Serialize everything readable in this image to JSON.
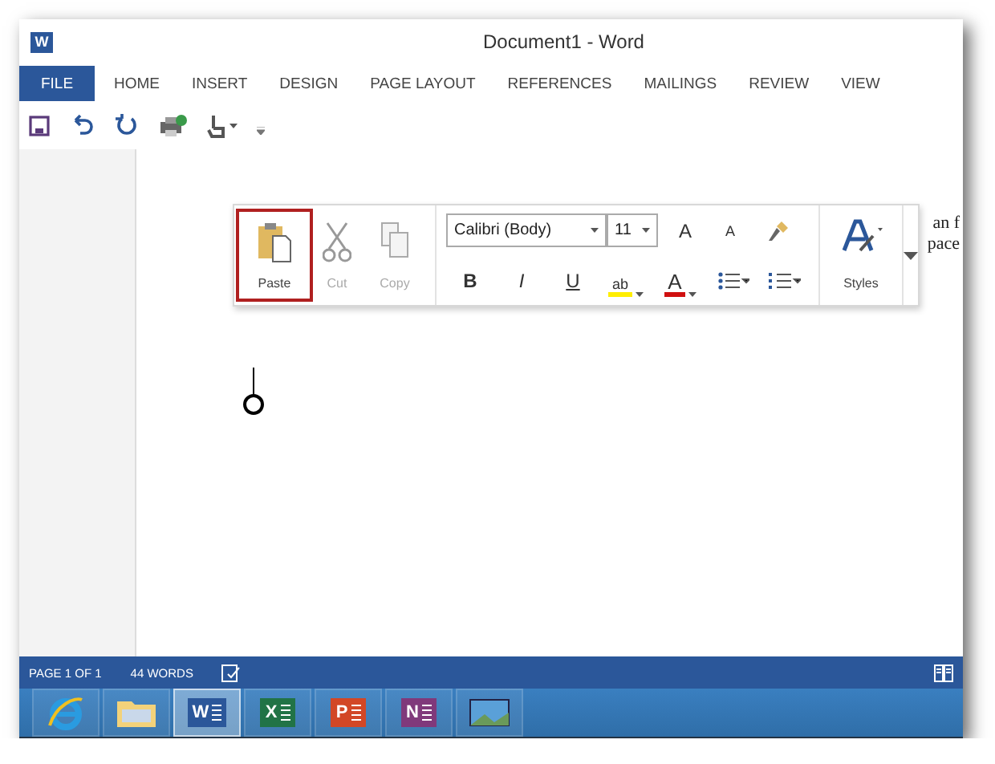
{
  "window": {
    "title": "Document1 - Word",
    "app_icon_letter": "W"
  },
  "tabs": [
    {
      "label": "FILE",
      "kind": "file"
    },
    {
      "label": "HOME",
      "kind": "tab"
    },
    {
      "label": "INSERT",
      "kind": "tab"
    },
    {
      "label": "DESIGN",
      "kind": "tab"
    },
    {
      "label": "PAGE LAYOUT",
      "kind": "tab"
    },
    {
      "label": "REFERENCES",
      "kind": "tab"
    },
    {
      "label": "MAILINGS",
      "kind": "tab"
    },
    {
      "label": "REVIEW",
      "kind": "tab"
    },
    {
      "label": "VIEW",
      "kind": "tab"
    }
  ],
  "quick_access": [
    {
      "kind": "save"
    },
    {
      "kind": "undo"
    },
    {
      "kind": "redo"
    },
    {
      "kind": "print"
    },
    {
      "kind": "touch"
    },
    {
      "kind": "customize"
    }
  ],
  "mini_toolbar": {
    "clipboard": [
      {
        "label": "Paste",
        "kind": "paste",
        "highlighted": true,
        "disabled": false
      },
      {
        "label": "Cut",
        "kind": "cut",
        "highlighted": false,
        "disabled": true
      },
      {
        "label": "Copy",
        "kind": "copy",
        "highlighted": false,
        "disabled": true
      }
    ],
    "font": {
      "value": "Calibri (Body)"
    },
    "size": {
      "value": "11"
    },
    "grow_label": "A",
    "shrink_label": "A",
    "format_buttons": [
      {
        "label": "B",
        "kind": "bold"
      },
      {
        "label": "I",
        "kind": "italic"
      },
      {
        "label": "U",
        "kind": "underline"
      }
    ],
    "color_buttons": [
      {
        "label": "ab",
        "kind": "highlight",
        "color": "#ffee00"
      },
      {
        "label": "A",
        "kind": "font",
        "color": "#d01010"
      }
    ],
    "styles_label": "Styles"
  },
  "document": {
    "text_fragments": [
      "an f",
      "pace"
    ]
  },
  "status_bar": {
    "page": "PAGE 1 OF 1",
    "words": "44 WORDS"
  },
  "taskbar": [
    {
      "kind": "browser",
      "selected": false
    },
    {
      "kind": "folder",
      "selected": false
    },
    {
      "kind": "app",
      "letter": "W",
      "color": "#2b579a",
      "selected": true
    },
    {
      "kind": "app",
      "letter": "X",
      "color": "#217346",
      "selected": false
    },
    {
      "kind": "app",
      "letter": "P",
      "color": "#d24726",
      "selected": false
    },
    {
      "kind": "app",
      "letter": "N",
      "color": "#80397b",
      "selected": false
    },
    {
      "kind": "photos",
      "selected": false
    }
  ]
}
